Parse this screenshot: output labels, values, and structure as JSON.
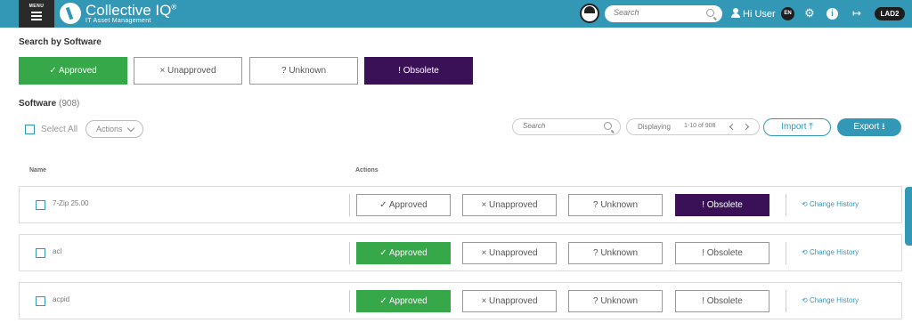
{
  "header": {
    "menu_label": "MENU",
    "logo_title": "Collective IQ",
    "logo_sup": "®",
    "logo_subtitle": "IT Asset Management",
    "search_placeholder": "Search",
    "user_greeting": "Hi User",
    "language": "EN",
    "environment": "LAD2",
    "icons": [
      "menu-icon",
      "logo-icon",
      "avatar",
      "search-icon",
      "user-icon",
      "gear-icon",
      "info-icon",
      "logout-icon"
    ]
  },
  "filter": {
    "title": "Search by Software",
    "buttons": [
      {
        "label": "✓ Approved",
        "style": "approved"
      },
      {
        "label": "× Unapproved",
        "style": "outline"
      },
      {
        "label": "? Unknown",
        "style": "outline"
      },
      {
        "label": "! Obsolete",
        "style": "obsolete"
      }
    ]
  },
  "software": {
    "title": "Software",
    "count": "(908)",
    "select_all": "Select All",
    "actions": "Actions",
    "search_placeholder": "Search",
    "displaying_label": "Displaying",
    "range": "1-10 of 908",
    "import_label": "Import ⤒",
    "export_label": "Export ⭳"
  },
  "table": {
    "columns": [
      "Name",
      "Actions"
    ],
    "history_label": "Change History",
    "rows": [
      {
        "name": "7-Zip 25.00",
        "buttons": [
          "✓ Approved",
          "× Unapproved",
          "? Unknown",
          "! Obsolete"
        ],
        "active": "obsolete"
      },
      {
        "name": "acl",
        "buttons": [
          "✓ Approved",
          "× Unapproved",
          "? Unknown",
          "! Obsolete"
        ],
        "active": "approved"
      },
      {
        "name": "acpid",
        "buttons": [
          "✓ Approved",
          "× Unapproved",
          "? Unknown",
          "! Obsolete"
        ],
        "active": "approved"
      }
    ]
  },
  "colors": {
    "brand": "#3398b6",
    "approved": "#37a84a",
    "obsolete": "#3a1057",
    "dark": "#1d1d1d"
  }
}
